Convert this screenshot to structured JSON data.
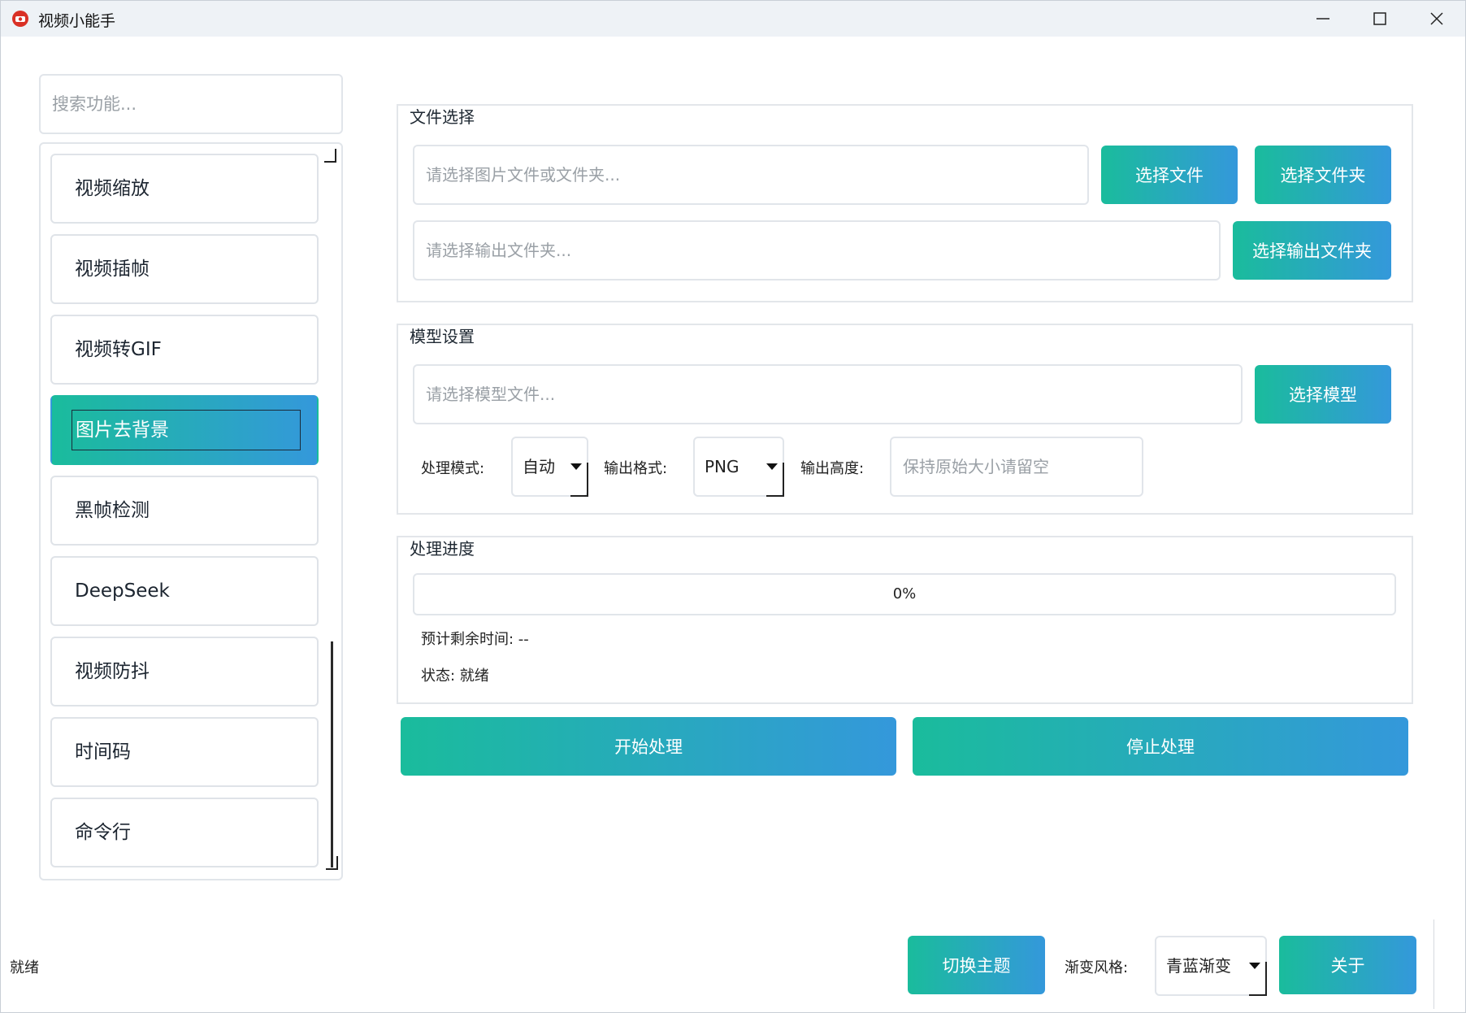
{
  "window": {
    "title": "视频小能手",
    "accent_start": "#1abc9c",
    "accent_end": "#3498db"
  },
  "sidebar": {
    "search_placeholder": "搜索功能...",
    "items": [
      {
        "label": "视频缩放"
      },
      {
        "label": "视频插帧"
      },
      {
        "label": "视频转GIF"
      },
      {
        "label": "图片去背景",
        "active": true
      },
      {
        "label": "黑帧检测"
      },
      {
        "label": "DeepSeek"
      },
      {
        "label": "视频防抖"
      },
      {
        "label": "时间码"
      },
      {
        "label": "命令行"
      }
    ]
  },
  "file_section": {
    "title": "文件选择",
    "input_placeholder": "请选择图片文件或文件夹...",
    "select_file_label": "选择文件",
    "select_folder_label": "选择文件夹",
    "output_placeholder": "请选择输出文件夹...",
    "select_output_label": "选择输出文件夹"
  },
  "model_section": {
    "title": "模型设置",
    "model_placeholder": "请选择模型文件...",
    "select_model_label": "选择模型",
    "mode_label": "处理模式:",
    "mode_value": "自动",
    "format_label": "输出格式:",
    "format_value": "PNG",
    "height_label": "输出高度:",
    "height_placeholder": "保持原始大小请留空"
  },
  "progress_section": {
    "title": "处理进度",
    "progress_text": "0%",
    "progress_value": 0,
    "eta_label": "预计剩余时间: --",
    "status_label": "状态: 就绪"
  },
  "actions": {
    "start_label": "开始处理",
    "stop_label": "停止处理"
  },
  "footer": {
    "status": "就绪",
    "theme_button": "切换主题",
    "gradient_label": "渐变风格:",
    "gradient_value": "青蓝渐变",
    "about_button": "关于"
  }
}
